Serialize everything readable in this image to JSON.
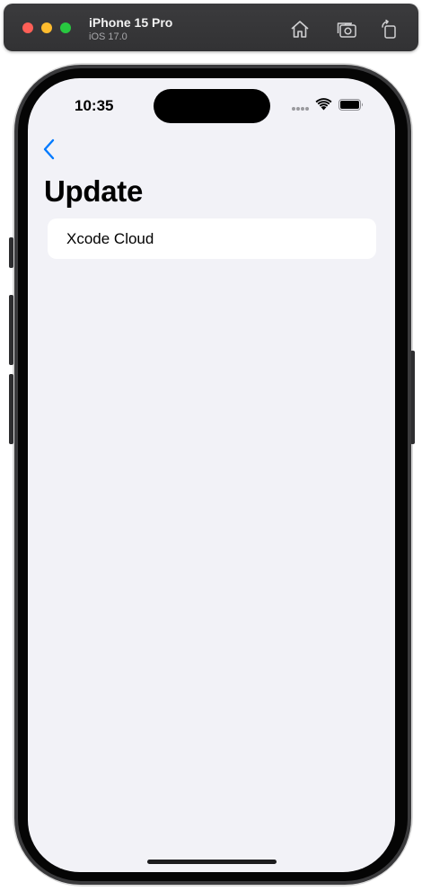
{
  "window": {
    "device_name": "iPhone 15 Pro",
    "os_version": "iOS 17.0",
    "toolbar": {
      "home_icon": "home-icon",
      "screenshot_icon": "screenshot-icon",
      "rotate_icon": "rotate-icon"
    }
  },
  "status_bar": {
    "time": "10:35",
    "icons": [
      "cellular-dots-icon",
      "wifi-icon",
      "battery-icon"
    ]
  },
  "nav": {
    "back_icon": "chevron-left-icon",
    "title": "Update"
  },
  "list": {
    "items": [
      {
        "label": "Xcode Cloud"
      }
    ]
  },
  "colors": {
    "accent": "#007aff",
    "background": "#f2f2f7",
    "cell_background": "#ffffff",
    "titlebar": "#363638"
  }
}
